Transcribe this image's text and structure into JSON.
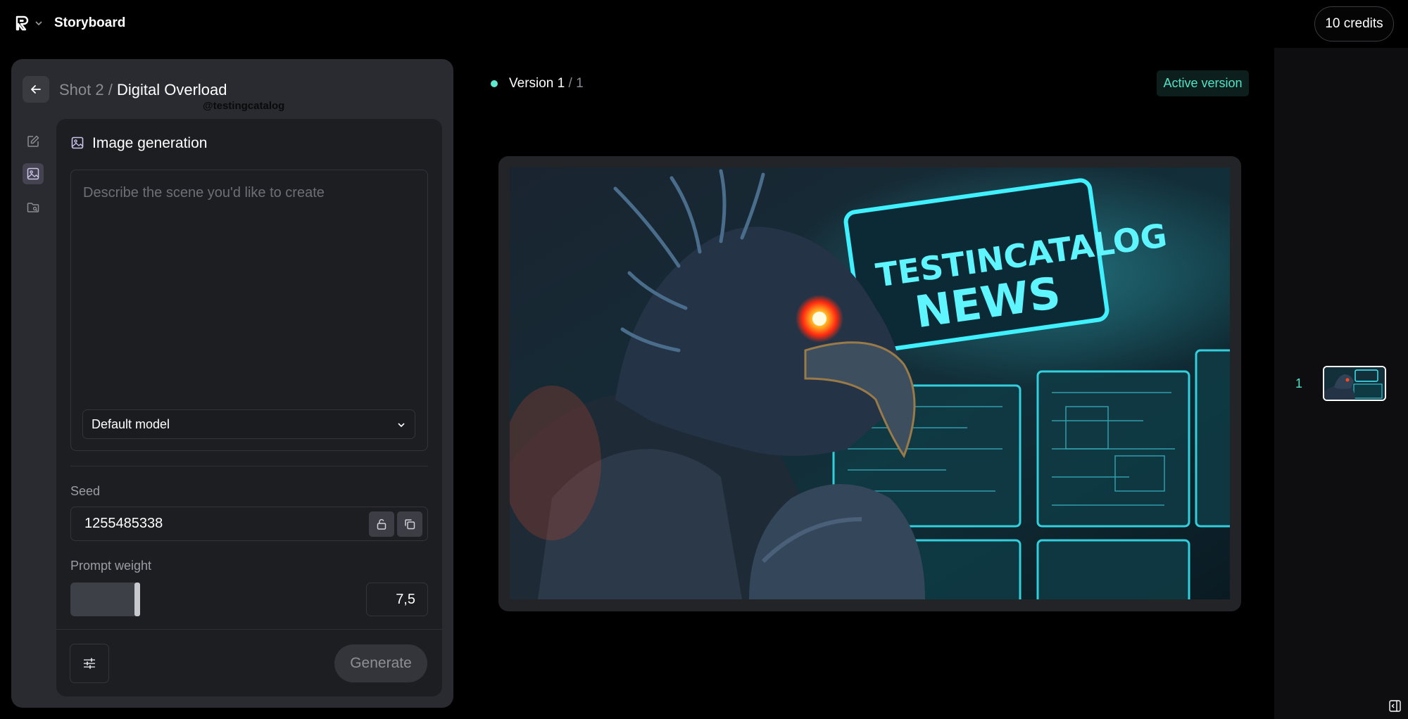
{
  "topbar": {
    "app_title": "Storyboard",
    "credits_label": "10 credits",
    "logo_icon": "brand-logo-icon",
    "menu_icon": "chevron-down-icon"
  },
  "panel": {
    "breadcrumb_parent": "Shot 2 /",
    "breadcrumb_current": "Digital Overload",
    "watermark": "@testingcatalog",
    "rail": [
      {
        "icon": "edit-icon",
        "active": false
      },
      {
        "icon": "image-icon",
        "active": true
      },
      {
        "icon": "folder-search-icon",
        "active": false
      }
    ],
    "section_title": "Image generation",
    "prompt_placeholder": "Describe the scene you'd like to create",
    "model_select": "Default model",
    "seed_label": "Seed",
    "seed_value": "1255485338",
    "prompt_weight_label": "Prompt weight",
    "prompt_weight_value": "7,5",
    "generate_label": "Generate"
  },
  "main": {
    "version_current": "Version 1",
    "version_total": "/ 1",
    "active_version_label": "Active version",
    "image_caption_line1": "TESTINCATALOG",
    "image_caption_line2": "NEWS"
  },
  "strip": {
    "thumb_number": "1"
  },
  "colors": {
    "accent": "#52e3c6",
    "panel_bg": "#2a2b31",
    "inner_bg": "#1d1e22"
  }
}
